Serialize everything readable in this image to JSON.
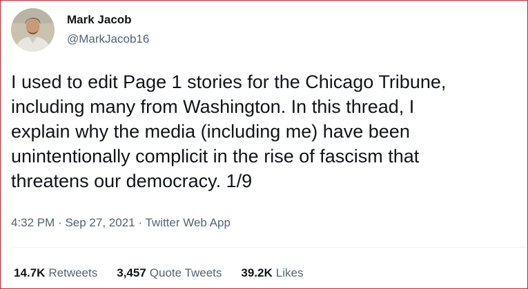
{
  "author": {
    "display_name": "Mark Jacob",
    "handle": "@MarkJacob16"
  },
  "tweet": {
    "text": "I used to edit Page 1 stories for the Chicago Tribune,\nincluding many from Washington. In this thread, I\nexplain why the media (including me) have been\nunintentionally complicit in the rise of fascism that\nthreatens our democracy. 1/9"
  },
  "meta": {
    "time": "4:32 PM",
    "separator": "·",
    "date": "Sep 27, 2021",
    "client": "Twitter Web App"
  },
  "stats": {
    "retweets_count": "14.7K",
    "retweets_label": "Retweets",
    "quotes_count": "3,457",
    "quotes_label": "Quote Tweets",
    "likes_count": "39.2K",
    "likes_label": "Likes"
  },
  "colors": {
    "text": "#0f1419",
    "secondary": "#536471",
    "border": "#c8232c"
  }
}
